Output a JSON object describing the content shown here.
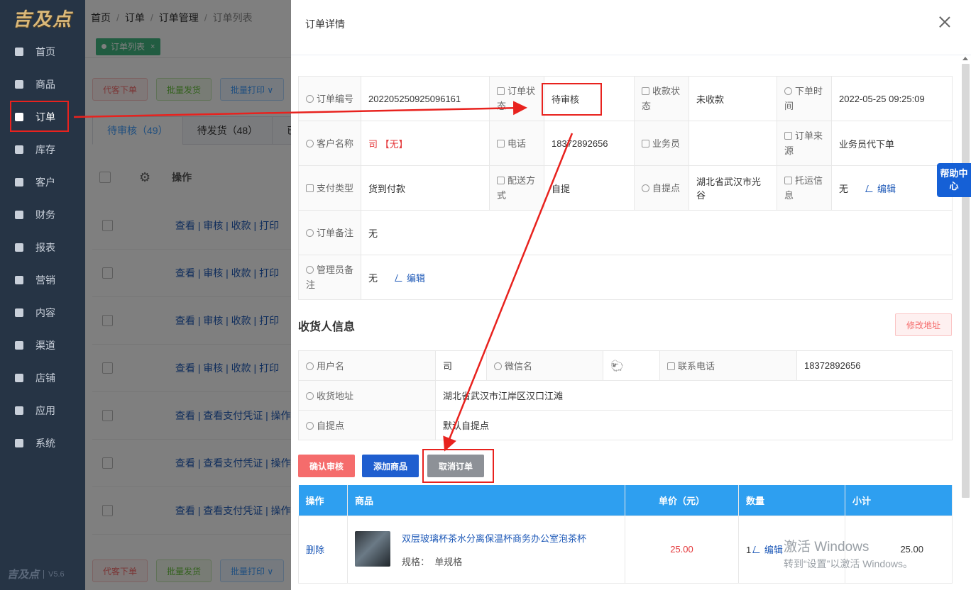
{
  "sidebar": {
    "logo": "吉及点",
    "items": [
      {
        "label": "首页",
        "icon": "home-icon"
      },
      {
        "label": "商品",
        "icon": "cart-icon"
      },
      {
        "label": "订单",
        "icon": "order-icon"
      },
      {
        "label": "库存",
        "icon": "grid-icon"
      },
      {
        "label": "客户",
        "icon": "user-icon"
      },
      {
        "label": "财务",
        "icon": "finance-icon"
      },
      {
        "label": "报表",
        "icon": "bar-chart-icon"
      },
      {
        "label": "营销",
        "icon": "marketing-icon"
      },
      {
        "label": "内容",
        "icon": "content-icon"
      },
      {
        "label": "渠道",
        "icon": "channel-icon"
      },
      {
        "label": "店铺",
        "icon": "store-icon"
      },
      {
        "label": "应用",
        "icon": "app-icon"
      },
      {
        "label": "系统",
        "icon": "monitor-icon"
      }
    ],
    "footer_logo": "吉及点",
    "version": "V5.6"
  },
  "breadcrumb": [
    "首页",
    "订单",
    "订单管理",
    "订单列表"
  ],
  "tags": {
    "active": "订单列表",
    "close": "×"
  },
  "toolbar_top": {
    "proxy_order": "代客下单",
    "batch_ship": "批量发货",
    "batch_print": "批量打印 ∨"
  },
  "toolbar_bottom": {
    "proxy_order": "代客下单",
    "batch_ship": "批量发货",
    "batch_print": "批量打印 ∨"
  },
  "status_tabs": {
    "pending_review": "待审核（49）",
    "pending_ship": "待发货（48）",
    "more": "已"
  },
  "list": {
    "header_op": "操作",
    "rows": [
      "查看 | 审核 | 收款 | 打印",
      "查看 | 审核 | 收款 | 打印",
      "查看 | 审核 | 收款 | 打印",
      "查看 | 审核 | 收款 | 打印",
      "查看 | 查看支付凭证 | 操作",
      "查看 | 查看支付凭证 | 操作",
      "查看 | 查看支付凭证 | 操作"
    ]
  },
  "drawer": {
    "title": "订单详情",
    "info": {
      "order_no_label": "订单编号",
      "order_no": "202205250925096161",
      "status_label": "订单状态",
      "status": "待审核",
      "payment_status_label": "收款状态",
      "payment_status": "未收款",
      "order_time_label": "下单时间",
      "order_time": "2022-05-25 09:25:09",
      "customer_label": "客户名称",
      "customer_name": "司",
      "customer_tag": "【无】",
      "phone_label": "电话",
      "phone": "18372892656",
      "salesman_label": "业务员",
      "salesman": "",
      "source_label": "订单来源",
      "source": "业务员代下单",
      "pay_type_label": "支付类型",
      "pay_type": "货到付款",
      "delivery_label": "配送方式",
      "delivery": "自提",
      "pickup_label": "自提点",
      "pickup": "湖北省武汉市光谷",
      "shipping_label": "托运信息",
      "shipping": "无",
      "remark_label": "订单备注",
      "remark": "无",
      "admin_remark_label": "管理员备注",
      "admin_remark": "无",
      "edit": "编辑"
    },
    "receiver_title": "收货人信息",
    "modify_address": "修改地址",
    "receiver": {
      "username_label": "用户名",
      "username": "司",
      "wechat_label": "微信名",
      "phone_label": "联系电话",
      "phone": "18372892656",
      "address_label": "收货地址",
      "address": "湖北省武汉市江岸区汉口江滩",
      "pickup_label": "自提点",
      "pickup": "默认自提点"
    },
    "actions": {
      "confirm": "确认审核",
      "add_goods": "添加商品",
      "cancel_order": "取消订单"
    },
    "goods_table": {
      "headers": [
        "操作",
        "商品",
        "单价（元）",
        "数量",
        "小计"
      ],
      "rows": [
        {
          "op": "删除",
          "name": "双层玻璃杯茶水分离保温杯商务办公室泡茶杯",
          "spec_label": "规格：",
          "spec": "单规格",
          "price": "25.00",
          "qty": "1",
          "edit": "编辑",
          "subtotal": "25.00"
        }
      ]
    }
  },
  "help": "帮助中心",
  "watermark": {
    "line1": "激活 Windows",
    "line2": "转到“设置”以激活 Windows。"
  },
  "colors": {
    "annotation": "#e8221e",
    "sidebar_bg": "#263445",
    "table_header": "#2e9ff0",
    "help_bg": "#1560d6"
  }
}
